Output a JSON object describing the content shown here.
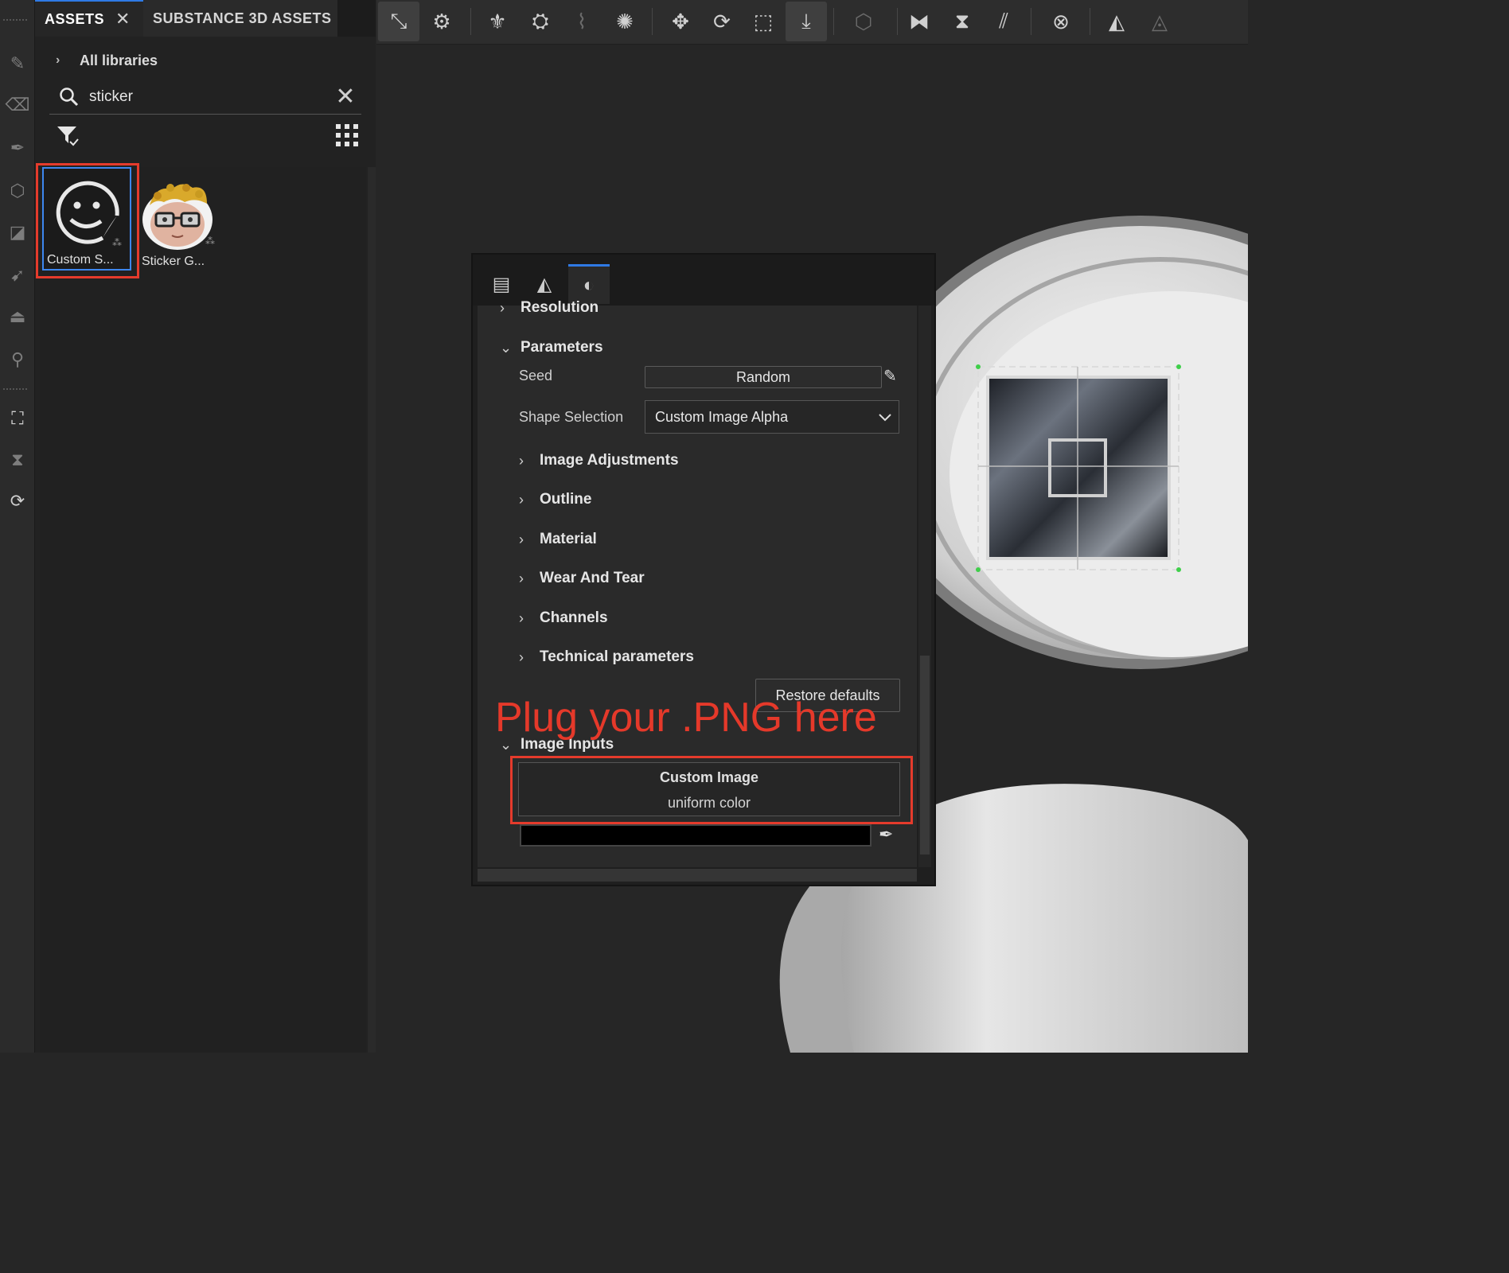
{
  "tool_strip": {
    "icons": [
      "paint-brush-icon",
      "eraser-icon",
      "projection-icon",
      "geometry-fill-icon",
      "polygon-fill-icon",
      "smudge-icon",
      "clone-icon",
      "color-picker-icon",
      "bake-icon",
      "history-icon",
      "sync-icon"
    ]
  },
  "assets_panel": {
    "tabs": [
      {
        "label": "ASSETS",
        "close": "✕"
      },
      {
        "label": "SUBSTANCE 3D ASSETS"
      }
    ],
    "breadcrumb": "All libraries",
    "search": {
      "value": "sticker",
      "clear": "✕"
    },
    "items": [
      {
        "caption": "Custom S...",
        "selected": true
      },
      {
        "caption": "Sticker G...",
        "selected": false
      }
    ]
  },
  "toolbar": {
    "icons": [
      "uv-transform-icon",
      "uv-transform-settings-icon",
      "lasso-icon",
      "lasso-settings-icon",
      "path-icon",
      "particles-icon",
      "move-icon",
      "rotate-icon",
      "scale-icon",
      "stamp-download-icon",
      "cube-icon",
      "mirror-x-icon",
      "mirror-y-icon",
      "mirror-diag-icon",
      "reset-icon",
      "symmetry-icon",
      "symmetry-settings-icon"
    ]
  },
  "properties": {
    "tabs": [
      "layer-settings-icon",
      "symmetry-tab-icon",
      "material-tab-icon"
    ],
    "sections": {
      "resolution": "Resolution",
      "parameters": "Parameters",
      "image_inputs": "Image Inputs"
    },
    "seed": {
      "label": "Seed",
      "value": "Random"
    },
    "shape_selection": {
      "label": "Shape Selection",
      "value": "Custom Image Alpha"
    },
    "groups": [
      "Image Adjustments",
      "Outline",
      "Material",
      "Wear And Tear",
      "Channels",
      "Technical parameters"
    ],
    "restore_defaults": "Restore defaults",
    "custom_image": {
      "title": "Custom Image",
      "subtitle": "uniform color"
    },
    "color_value": "#000000"
  },
  "annotation": {
    "text": "Plug your .PNG here",
    "color": "#e5392a"
  }
}
